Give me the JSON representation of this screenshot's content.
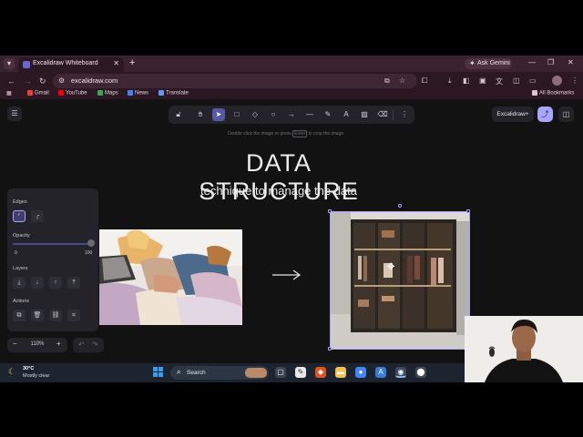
{
  "browser": {
    "tab_title": "Excalidraw Whiteboard",
    "url": "excalidraw.com",
    "gemini_label": "Ask Gemini",
    "bookmarks": [
      "Gmail",
      "YouTube",
      "Maps",
      "News",
      "Translate"
    ],
    "all_bookmarks": "All Bookmarks"
  },
  "toolbar": {
    "tools": [
      "lock",
      "hand",
      "selection",
      "rectangle",
      "diamond",
      "ellipse",
      "arrow",
      "line",
      "draw",
      "text",
      "image",
      "eraser",
      "more"
    ],
    "tool_numbers": [
      "",
      "",
      "1",
      "2",
      "3",
      "4",
      "5",
      "6",
      "7",
      "8",
      "9",
      "0",
      ""
    ],
    "active_tool": "selection"
  },
  "hint": {
    "before": "Double click the image or press",
    "key": "Enter",
    "after": "to crop the image"
  },
  "header": {
    "excalidraw_plus": "Excalidraw+"
  },
  "panel": {
    "edges_label": "Edges",
    "opacity_label": "Opacity",
    "opacity_min": "0",
    "opacity_max": "100",
    "opacity_value": 100,
    "layers_label": "Layers",
    "actions_label": "Actions"
  },
  "canvas": {
    "title": "DATA STRUCTURE",
    "subtitle": "technique to manage the data"
  },
  "zoom": {
    "value": "110%"
  },
  "taskbar": {
    "temperature": "30°C",
    "weather": "Mostly clear",
    "search_label": "Search"
  },
  "colors": {
    "accent": "#a8a5ff",
    "canvas_bg": "#121212",
    "panel_bg": "#232329"
  }
}
